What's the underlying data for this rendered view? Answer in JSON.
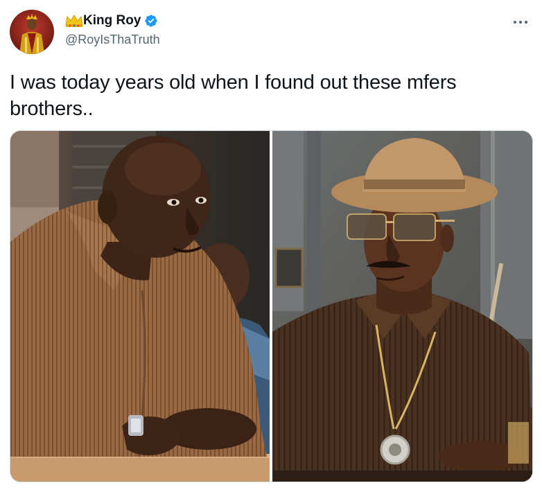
{
  "user": {
    "display_name": "King Roy",
    "handle": "@RoyIsThaTruth",
    "verified": true,
    "crown_icon": "crown-emoji-icon",
    "verified_icon": "verified-badge-icon"
  },
  "menu": {
    "icon": "more-options-icon"
  },
  "tweet": {
    "text": "I was today years old when I found out these mfers brothers.."
  },
  "media": {
    "count": 2
  },
  "colors": {
    "verified_blue": "#1d9bf0",
    "text_primary": "#0f1419",
    "text_secondary": "#536471",
    "border": "#cfd9de"
  }
}
